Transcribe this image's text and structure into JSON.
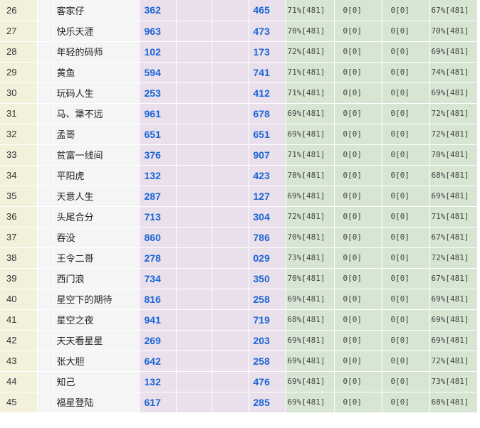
{
  "rows": [
    {
      "idx": "26",
      "name": "客家仔",
      "num1": "362",
      "num2": "465",
      "s1": "71%[481]",
      "s2": "0[0]",
      "s3": "0[0]",
      "s4": "67%[481]"
    },
    {
      "idx": "27",
      "name": "快乐天涯",
      "num1": "963",
      "num2": "473",
      "s1": "70%[481]",
      "s2": "0[0]",
      "s3": "0[0]",
      "s4": "70%[481]"
    },
    {
      "idx": "28",
      "name": "年轻的码师",
      "num1": "102",
      "num2": "173",
      "s1": "72%[481]",
      "s2": "0[0]",
      "s3": "0[0]",
      "s4": "69%[481]"
    },
    {
      "idx": "29",
      "name": "黄鱼",
      "num1": "594",
      "num2": "741",
      "s1": "71%[481]",
      "s2": "0[0]",
      "s3": "0[0]",
      "s4": "74%[481]"
    },
    {
      "idx": "30",
      "name": "玩码人生",
      "num1": "253",
      "num2": "412",
      "s1": "71%[481]",
      "s2": "0[0]",
      "s3": "0[0]",
      "s4": "69%[481]"
    },
    {
      "idx": "31",
      "name": "马、犟不远",
      "num1": "961",
      "num2": "678",
      "s1": "69%[481]",
      "s2": "0[0]",
      "s3": "0[0]",
      "s4": "72%[481]"
    },
    {
      "idx": "32",
      "name": "孟哥",
      "num1": "651",
      "num2": "651",
      "s1": "69%[481]",
      "s2": "0[0]",
      "s3": "0[0]",
      "s4": "72%[481]"
    },
    {
      "idx": "33",
      "name": "贫富一线间",
      "num1": "376",
      "num2": "907",
      "s1": "71%[481]",
      "s2": "0[0]",
      "s3": "0[0]",
      "s4": "70%[481]"
    },
    {
      "idx": "34",
      "name": "平阳虎",
      "num1": "132",
      "num2": "423",
      "s1": "70%[481]",
      "s2": "0[0]",
      "s3": "0[0]",
      "s4": "68%[481]"
    },
    {
      "idx": "35",
      "name": "天意人生",
      "num1": "287",
      "num2": "127",
      "s1": "69%[481]",
      "s2": "0[0]",
      "s3": "0[0]",
      "s4": "69%[481]"
    },
    {
      "idx": "36",
      "name": "头尾合分",
      "num1": "713",
      "num2": "304",
      "s1": "72%[481]",
      "s2": "0[0]",
      "s3": "0[0]",
      "s4": "71%[481]"
    },
    {
      "idx": "37",
      "name": "吞没",
      "num1": "860",
      "num2": "786",
      "s1": "70%[481]",
      "s2": "0[0]",
      "s3": "0[0]",
      "s4": "67%[481]"
    },
    {
      "idx": "38",
      "name": "王令二哥",
      "num1": "278",
      "num2": "029",
      "s1": "73%[481]",
      "s2": "0[0]",
      "s3": "0[0]",
      "s4": "72%[481]"
    },
    {
      "idx": "39",
      "name": "西门浪",
      "num1": "734",
      "num2": "350",
      "s1": "70%[481]",
      "s2": "0[0]",
      "s3": "0[0]",
      "s4": "67%[481]"
    },
    {
      "idx": "40",
      "name": "星空下的期待",
      "num1": "816",
      "num2": "258",
      "s1": "69%[481]",
      "s2": "0[0]",
      "s3": "0[0]",
      "s4": "69%[481]"
    },
    {
      "idx": "41",
      "name": "星空之夜",
      "num1": "941",
      "num2": "719",
      "s1": "68%[481]",
      "s2": "0[0]",
      "s3": "0[0]",
      "s4": "69%[481]"
    },
    {
      "idx": "42",
      "name": "天天看星星",
      "num1": "269",
      "num2": "203",
      "s1": "69%[481]",
      "s2": "0[0]",
      "s3": "0[0]",
      "s4": "69%[481]"
    },
    {
      "idx": "43",
      "name": "张大胆",
      "num1": "642",
      "num2": "258",
      "s1": "69%[481]",
      "s2": "0[0]",
      "s3": "0[0]",
      "s4": "72%[481]"
    },
    {
      "idx": "44",
      "name": "知己",
      "num1": "132",
      "num2": "476",
      "s1": "69%[481]",
      "s2": "0[0]",
      "s3": "0[0]",
      "s4": "73%[481]"
    },
    {
      "idx": "45",
      "name": "福星登陆",
      "num1": "617",
      "num2": "285",
      "s1": "69%[481]",
      "s2": "0[0]",
      "s3": "0[0]",
      "s4": "68%[481]"
    }
  ],
  "colors": {
    "index_bg": "#f3f1dc",
    "name_bg": "#f5f5f5",
    "number_bg": "#e9e0ec",
    "number_text": "#1a64d6",
    "stat_bg": "#d6e6d3"
  }
}
